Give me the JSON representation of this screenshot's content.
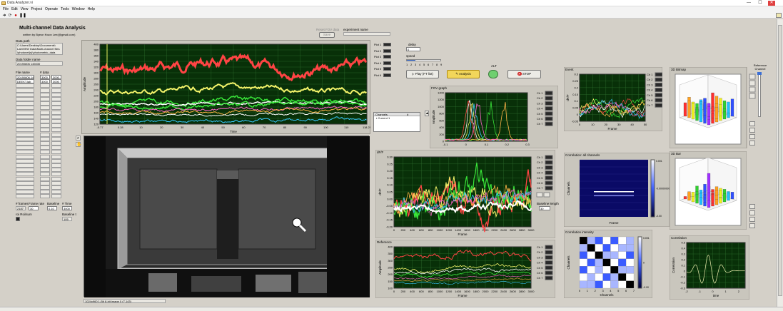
{
  "window": {
    "title": "Data Analyzer.vi",
    "controls": {
      "minimize": "—",
      "maximize": "☐",
      "close": "✕"
    }
  },
  "menu": [
    "File",
    "Edit",
    "View",
    "Project",
    "Operate",
    "Tools",
    "Window",
    "Help"
  ],
  "header": {
    "title": "Multi-channel Data Analysis",
    "author": "written by Byeon Kwon Lee(@gmail.com)"
  },
  "left": {
    "data_path_label": "Data path",
    "data_path_value": [
      "C:\\Users\\Desktop\\Documents\\",
      "LabVIEW Data\\Multi-channel files",
      "\\photonet(s)\\photometric_data"
    ],
    "data_folder_label": "Data folder name",
    "data_folder_value": "20190806 145030",
    "file_name_label": "File name",
    "n_data_label": "# data",
    "file_rows": [
      [
        "20190806 145",
        "3000",
        "3000"
      ],
      [
        "DEEKT.lab",
        "3000",
        "3000"
      ]
    ],
    "frames_label": "# frames",
    "frames_value": "2187",
    "frame_rate_label": "Frame rate",
    "frame_rate_value": "30",
    "baseline_label": "Baseline",
    "baseline_value": "0.10",
    "n_time_label": "# Time",
    "n_time_value": "3000",
    "baseline_t_label": "Baseline t",
    "baseline_t_value": "105",
    "roi_label": "roi Roi/sum"
  },
  "top": {
    "reset_label": "Reset FOV data",
    "save_label": "Save",
    "experiment_label": "experiment name",
    "experiment_value": ""
  },
  "controls": {
    "delay_label": "delay",
    "delay_value": "0",
    "speed_label": "speed",
    "speed_ticks": [
      "1",
      "2",
      "3",
      "4",
      "5",
      "6",
      "7",
      "8",
      "9"
    ],
    "play_button": "Play (FT list)",
    "analysis_button": "Analysis",
    "alt_label": "ALT",
    "stop_button": "STOP"
  },
  "plot_switches": [
    "Plot 1",
    "Plot 2",
    "Plot 3",
    "Plot 4",
    "Plot 5",
    "Plot 6"
  ],
  "channel_labels": [
    "Ch 1",
    "Ch 2",
    "Ch 3",
    "Ch 4",
    "Ch 5",
    "Ch 6",
    "Ch 7"
  ],
  "channel_select": {
    "header": [
      "Channels",
      "",
      "#"
    ],
    "item": "Current 1"
  },
  "main_chart": {
    "ylabel": "Amplitude",
    "xlabel": "Time",
    "yticks": [
      "400",
      "380",
      "360",
      "340",
      "320",
      "300",
      "280",
      "260",
      "240",
      "220",
      "200",
      "180",
      "160",
      "140",
      "120"
    ],
    "xticks": [
      "-0.77",
      "0.28",
      "10",
      "20",
      "30",
      "40",
      "50",
      "60",
      "70",
      "80",
      "90",
      "100",
      "110",
      "118.29"
    ]
  },
  "camera": {
    "status": "1024x960 1-Bit 8-bit image 0",
    "coords": "(7.143)"
  },
  "fov_graph": {
    "title": "FOV graph",
    "ylabel": "Amplitude",
    "yticks": [
      "1400",
      "1200",
      "1000",
      "800",
      "600",
      "400",
      "200",
      "0"
    ],
    "xticks": [
      "-0.1",
      "0",
      "0.1",
      "0.2",
      "0.3"
    ]
  },
  "dff": {
    "title": "dF/F",
    "ylabel": "dF/F",
    "xlabel": "Frame",
    "yticks": [
      "0.30",
      "0.25",
      "0.20",
      "0.15",
      "0.10",
      "0.05",
      "0.00",
      "-0.05",
      "-0.10",
      "-0.15",
      "-0.20"
    ],
    "xticks": [
      "0",
      "100",
      "200",
      "300",
      "400",
      "500",
      "600",
      "700",
      "800",
      "900",
      "1000",
      "1100",
      "1200",
      "1300",
      "1400",
      "1500",
      "1600",
      "1700",
      "1800",
      "1900",
      "2000",
      "2100",
      "2200",
      "2300",
      "2400",
      "2500",
      "2600",
      "2700",
      "2800",
      "2900",
      "3000"
    ]
  },
  "baseline_length": {
    "label": "Baseline length",
    "value": "30"
  },
  "reference": {
    "title": "Reference",
    "ylabel": "Amplitude",
    "xlabel": "Frame",
    "yticks": [
      "400",
      "350",
      "300",
      "250",
      "200",
      "150",
      "100"
    ],
    "xticks": [
      "0",
      "100",
      "200",
      "300",
      "400",
      "500",
      "600",
      "700",
      "800",
      "900",
      "1000",
      "1100",
      "1200",
      "1300",
      "1400",
      "1500",
      "1600",
      "1700",
      "1800",
      "1900",
      "2000",
      "2100",
      "2200",
      "2300",
      "2400",
      "2500",
      "2600",
      "2700",
      "2800",
      "2900",
      "3000"
    ]
  },
  "event": {
    "title": "Event",
    "ylabel": "dF/F",
    "xlabel": "Frame",
    "yticks": [
      "0.3",
      "0.25",
      "0.2",
      "0.15",
      "0.1",
      "0.05",
      "0",
      "-0.05"
    ],
    "xticks": [
      "0",
      "5",
      "10",
      "15",
      "20",
      "25",
      "30",
      "35",
      "40",
      "45",
      "50"
    ]
  },
  "corr_all": {
    "title": "Correlation: all channels",
    "ylabel": "Channels",
    "xlabel": "Frame",
    "scale": [
      "0.001",
      "-0.000000000001",
      "-0.00"
    ]
  },
  "corr_intensity": {
    "title": "Correlation intensity",
    "ylabel": "Channels",
    "xlabel": "Channels",
    "scale": [
      "0.001",
      "0",
      "-0.00"
    ],
    "xticks": [
      "0",
      "1",
      "2",
      "3",
      "4",
      "5",
      "6",
      "7"
    ]
  },
  "bar3d_top": {
    "title": "3D Bitmap",
    "ref_label": "Reference Channel"
  },
  "bar3d_bottom": {
    "title": "3D Bar"
  },
  "correlation": {
    "title": "Correlation",
    "ylabel": "Correlation",
    "xlabel": "time",
    "yticks": [
      "0.5",
      "0.4",
      "0.3",
      "0.2",
      "0.1",
      "0",
      "-0.1",
      "-0.2",
      "-0.3"
    ],
    "xticks": [
      "-2",
      "-1.5",
      "-1",
      "-0.5",
      "0",
      "0.5",
      "1",
      "1.5",
      "2",
      "2.5"
    ]
  },
  "colors": {
    "panel": "#d4d0c8",
    "plot_bg": "#083008",
    "grid": "#2f6e2f",
    "red": "#ff4444",
    "yellow": "#f4f46a",
    "green": "#39e639",
    "white": "#ffffff",
    "cyan": "#39c8ff",
    "magenta": "#ff66cc",
    "orange": "#ffb347"
  },
  "icons": [
    "run-arrow-icon",
    "stop-circle-icon",
    "pause-icon",
    "zoom-icon",
    "hand-icon",
    "stop-x-icon",
    "led-icon"
  ]
}
